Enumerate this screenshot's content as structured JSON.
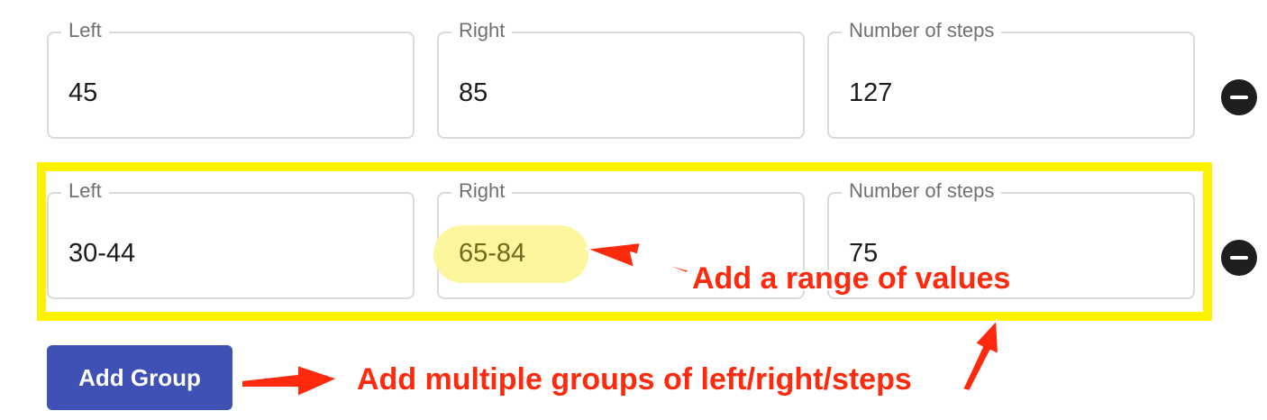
{
  "groups": [
    {
      "left": {
        "label": "Left",
        "value": "45"
      },
      "right": {
        "label": "Right",
        "value": "85"
      },
      "steps": {
        "label": "Number of steps",
        "value": "127"
      }
    },
    {
      "left": {
        "label": "Left",
        "value": "30-44"
      },
      "right": {
        "label": "Right",
        "value": "65-84"
      },
      "steps": {
        "label": "Number of steps",
        "value": "75"
      }
    }
  ],
  "actions": {
    "add_group_label": "Add Group"
  },
  "annotations": {
    "range_note": "Add a range of values",
    "groups_note": "Add multiple groups of left/right/steps",
    "highlight_color": "#fef200",
    "annotation_color": "#ff2a0d"
  },
  "colors": {
    "primary_button": "#3f51b5"
  }
}
